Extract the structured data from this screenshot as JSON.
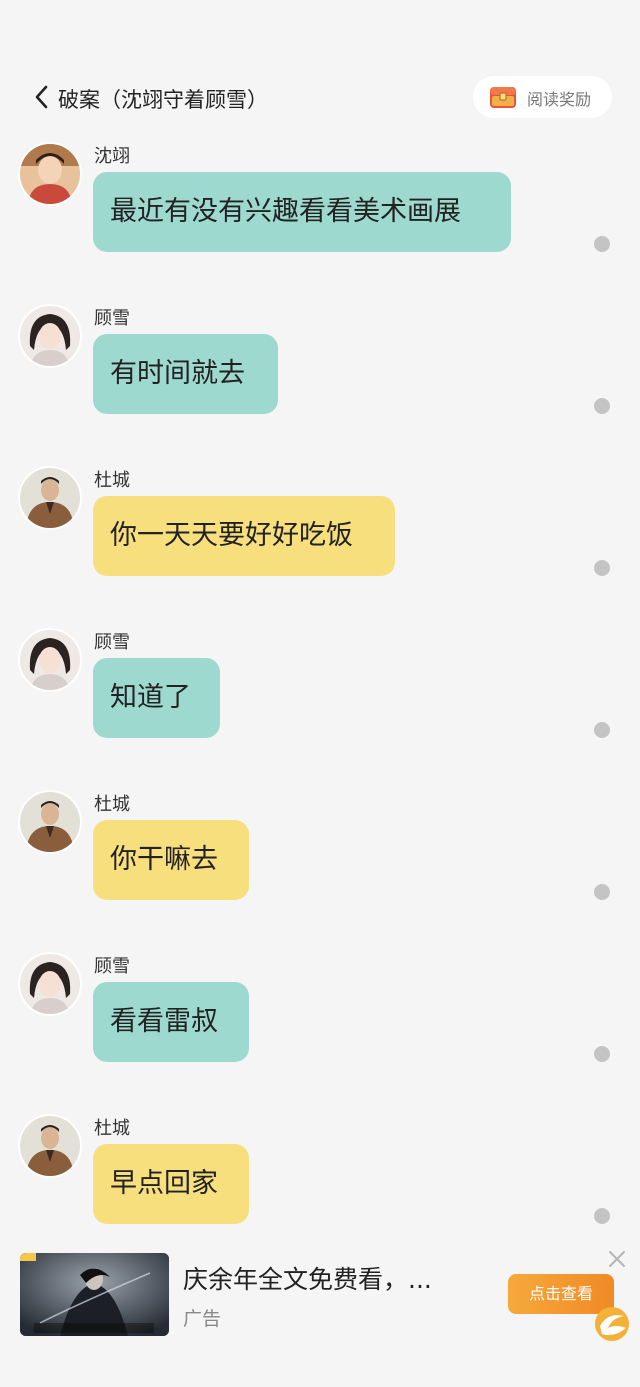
{
  "header": {
    "title": "破案（沈翊守着顾雪）",
    "reward_label": "阅读奖励",
    "back_icon": "chevron-left-icon",
    "reward_icon": "treasure-chest-icon"
  },
  "messages": [
    {
      "sender": "沈翊",
      "text": "最近有没有兴趣看看美术画展",
      "bubble_color": "#9ed9cf",
      "avatar": "avatar-shenyi"
    },
    {
      "sender": "顾雪",
      "text": "有时间就去",
      "bubble_color": "#9ed9cf",
      "avatar": "avatar-guxue"
    },
    {
      "sender": "杜城",
      "text": "你一天天要好好吃饭",
      "bubble_color": "#f8df7e",
      "avatar": "avatar-ducheng"
    },
    {
      "sender": "顾雪",
      "text": "知道了",
      "bubble_color": "#9ed9cf",
      "avatar": "avatar-guxue"
    },
    {
      "sender": "杜城",
      "text": "你干嘛去",
      "bubble_color": "#f8df7e",
      "avatar": "avatar-ducheng"
    },
    {
      "sender": "顾雪",
      "text": "看看雷叔",
      "bubble_color": "#9ed9cf",
      "avatar": "avatar-guxue"
    },
    {
      "sender": "杜城",
      "text": "早点回家",
      "bubble_color": "#f8df7e",
      "avatar": "avatar-ducheng"
    }
  ],
  "ad": {
    "title": "庆余年全文免费看，...",
    "label": "广告",
    "cta_label": "点击查看",
    "close_icon": "close-icon",
    "brand_icon": "brand-logo-icon"
  },
  "colors": {
    "background": "#f5f5f5",
    "teal_bubble": "#9ed9cf",
    "yellow_bubble": "#f8df7e",
    "cta_orange": "#f08a24",
    "read_dot": "#c4c4c4"
  }
}
